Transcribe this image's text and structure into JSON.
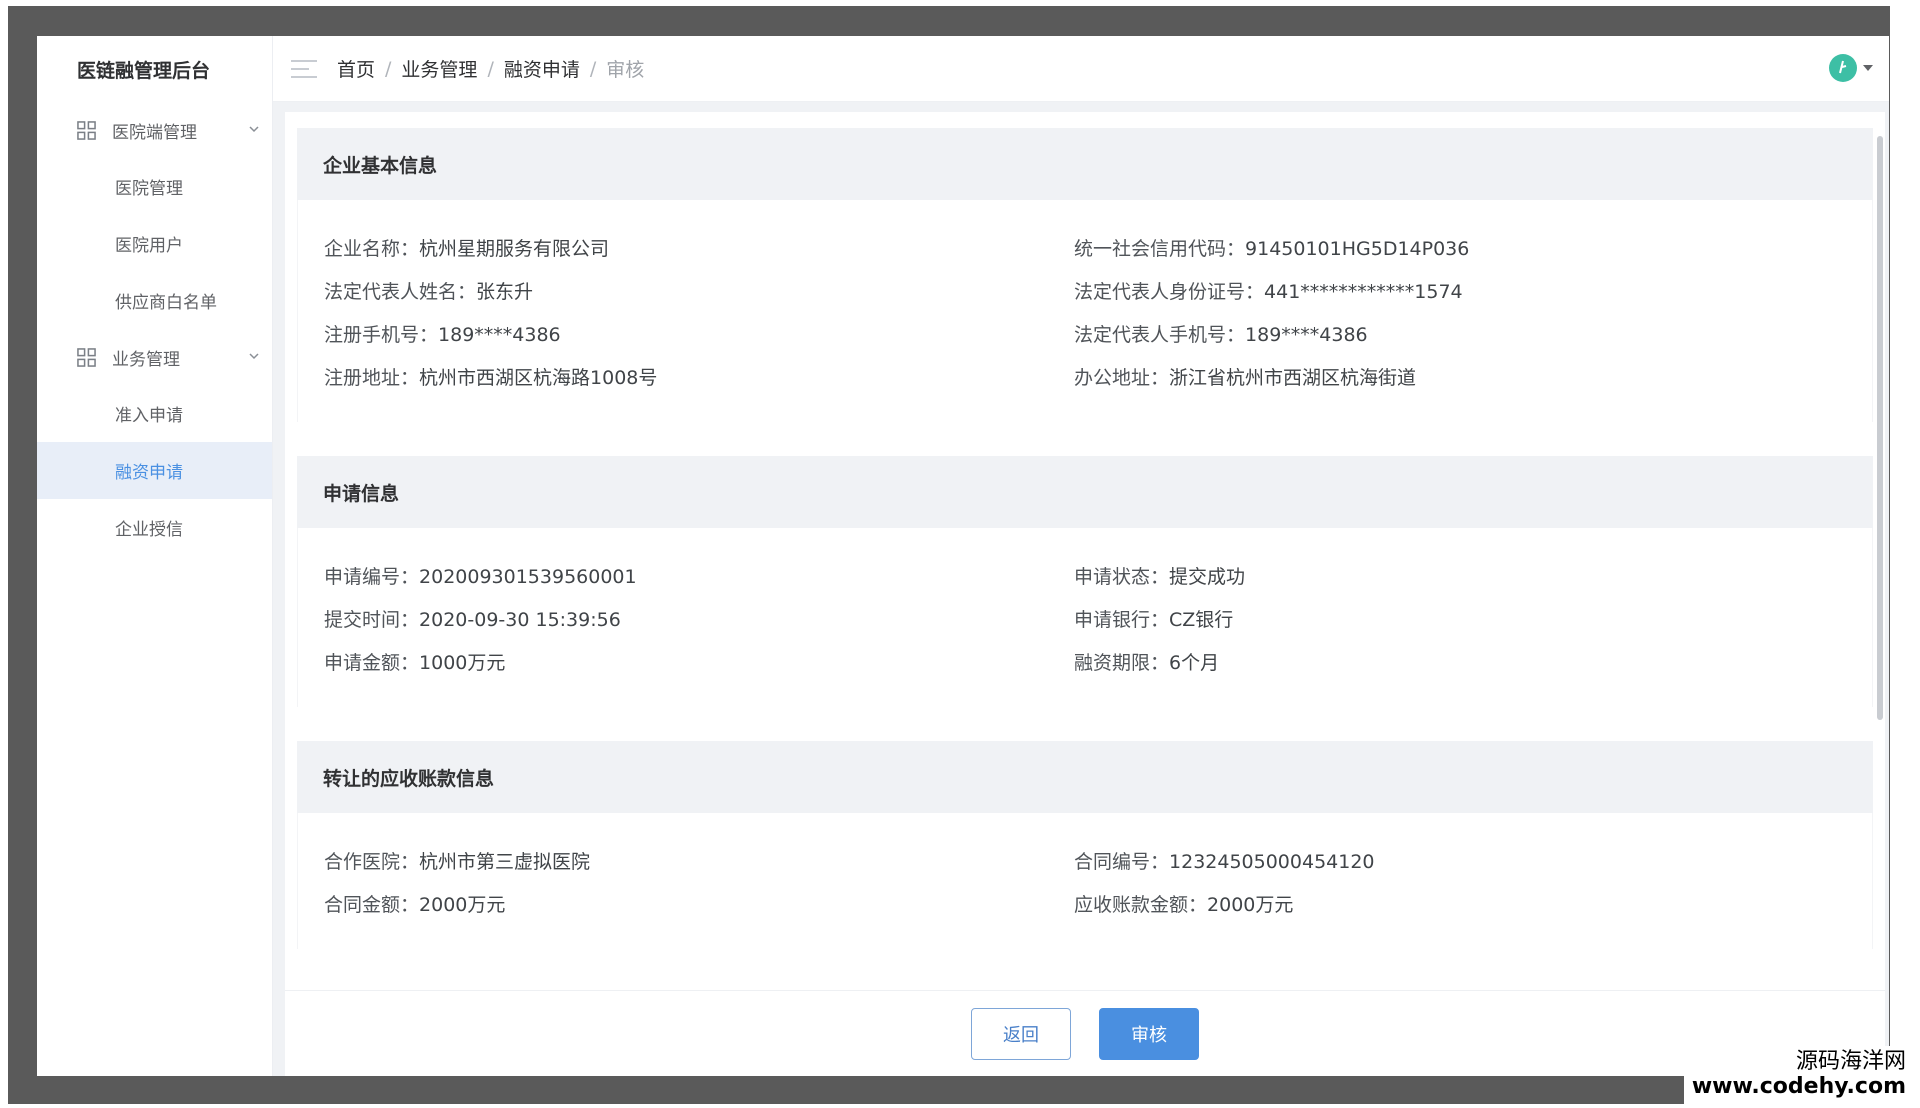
{
  "sidebar": {
    "title": "医链融管理后台",
    "groups": [
      {
        "label": "医院端管理",
        "items": [
          "医院管理",
          "医院用户",
          "供应商白名单"
        ]
      },
      {
        "label": "业务管理",
        "items": [
          "准入申请",
          "融资申请",
          "企业授信"
        ]
      }
    ],
    "active_item": "融资申请"
  },
  "breadcrumb": [
    "首页",
    "业务管理",
    "融资申请",
    "审核"
  ],
  "breadcrumb_sep": "/",
  "sections": {
    "company": {
      "title": "企业基本信息",
      "rows": [
        [
          {
            "k": "企业名称：",
            "v": "杭州星期服务有限公司"
          },
          {
            "k": "统一社会信用代码：",
            "v": "91450101HG5D14P036"
          }
        ],
        [
          {
            "k": "法定代表人姓名：",
            "v": "张东升"
          },
          {
            "k": "法定代表人身份证号：",
            "v": "441************1574"
          }
        ],
        [
          {
            "k": "注册手机号：",
            "v": "189****4386"
          },
          {
            "k": "法定代表人手机号：",
            "v": "189****4386"
          }
        ],
        [
          {
            "k": "注册地址：",
            "v": "杭州市西湖区杭海路1008号"
          },
          {
            "k": "办公地址：",
            "v": "浙江省杭州市西湖区杭海街道"
          }
        ]
      ]
    },
    "application": {
      "title": "申请信息",
      "rows": [
        [
          {
            "k": "申请编号：",
            "v": "202009301539560001"
          },
          {
            "k": "申请状态：",
            "v": "提交成功"
          }
        ],
        [
          {
            "k": "提交时间：",
            "v": "2020-09-30 15:39:56"
          },
          {
            "k": "申请银行：",
            "v": "CZ银行"
          }
        ],
        [
          {
            "k": "申请金额：",
            "v": "1000万元"
          },
          {
            "k": "融资期限：",
            "v": "6个月"
          }
        ]
      ]
    },
    "receivable": {
      "title": "转让的应收账款信息",
      "rows": [
        [
          {
            "k": "合作医院：",
            "v": "杭州市第三虚拟医院"
          },
          {
            "k": "合同编号：",
            "v": "12324505000454120"
          }
        ],
        [
          {
            "k": "合同金额：",
            "v": "2000万元"
          },
          {
            "k": "应收账款金额：",
            "v": "2000万元"
          }
        ]
      ]
    }
  },
  "footer": {
    "back_label": "返回",
    "audit_label": "审核"
  },
  "watermark": {
    "line1": "源码海洋网",
    "line2": "www.codehy.com"
  },
  "colors": {
    "accent": "#4a8fe0",
    "active_bg": "#e8eef8",
    "avatar": "#3dbfa5"
  }
}
